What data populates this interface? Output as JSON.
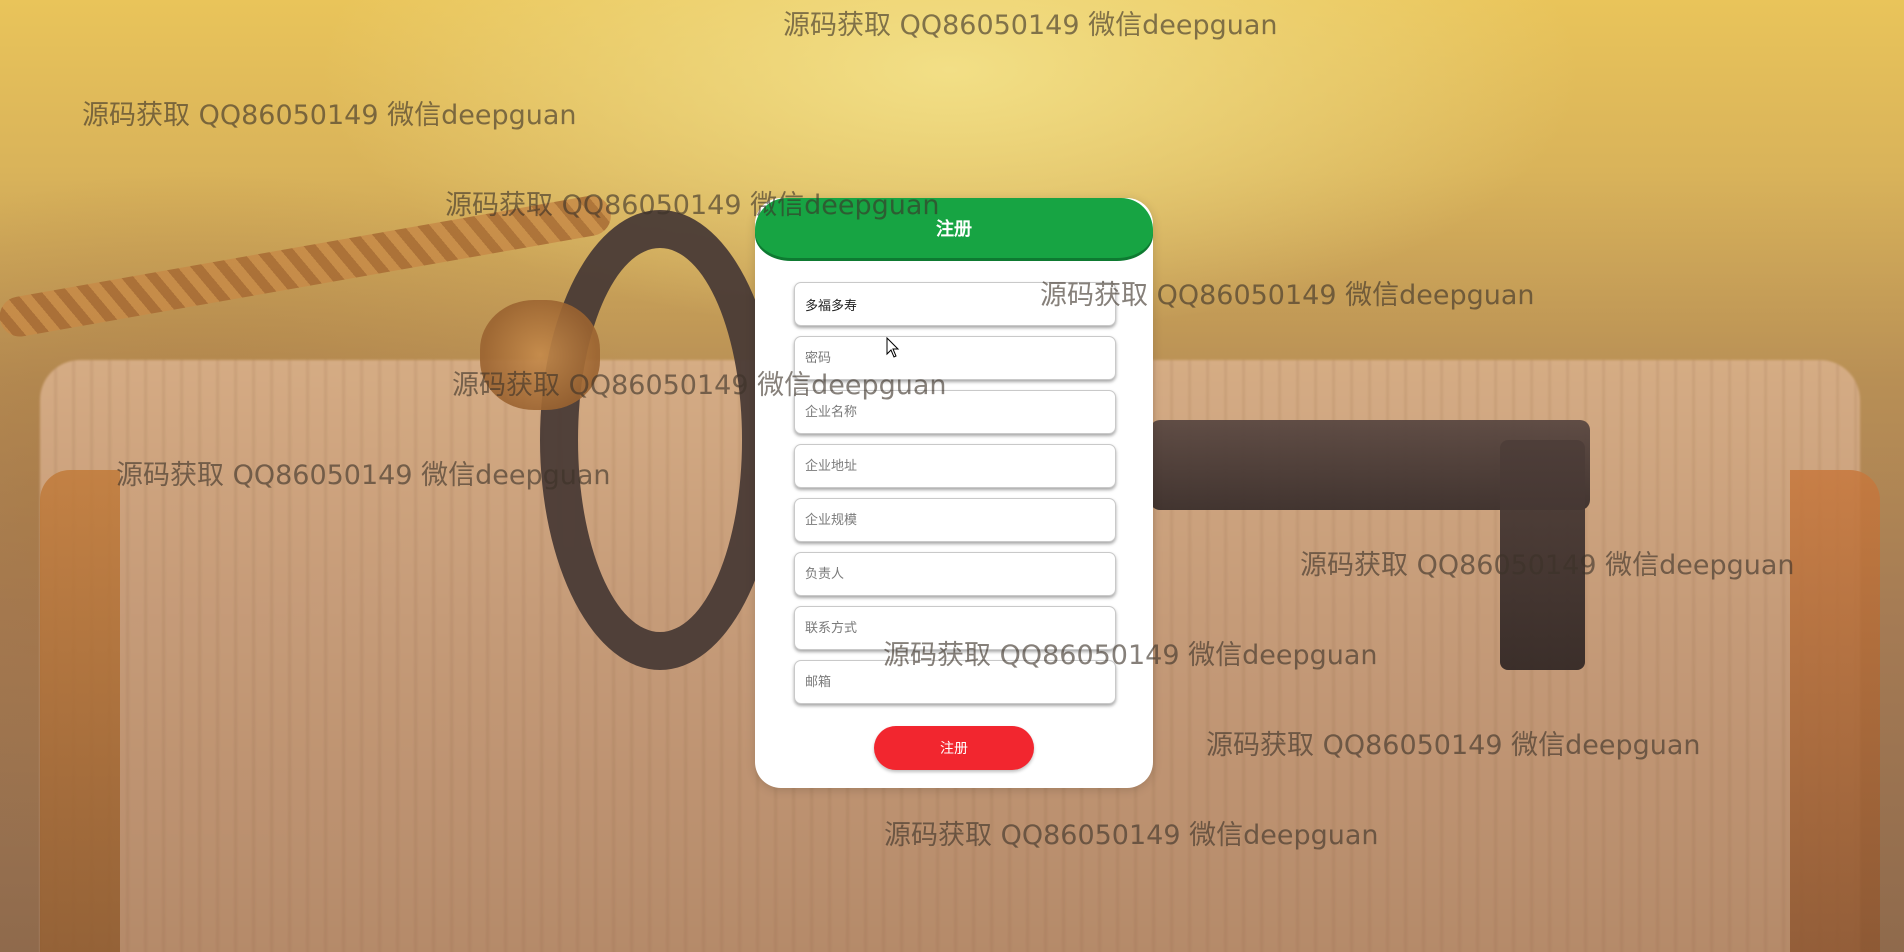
{
  "register_form": {
    "title": "注册",
    "fields": {
      "username": {
        "value": "多福多寿",
        "placeholder": ""
      },
      "password": {
        "value": "",
        "placeholder": "密码"
      },
      "company_name": {
        "value": "",
        "placeholder": "企业名称"
      },
      "company_address": {
        "value": "",
        "placeholder": "企业地址"
      },
      "company_size": {
        "value": "",
        "placeholder": "企业规模"
      },
      "contact_person": {
        "value": "",
        "placeholder": "负责人"
      },
      "phone": {
        "value": "",
        "placeholder": "联系方式"
      },
      "email": {
        "value": "",
        "placeholder": "邮箱"
      }
    },
    "submit_label": "注册"
  },
  "watermark_text": "源码获取 QQ86050149 微信deepguan",
  "colors": {
    "header_green": "#17a443",
    "submit_red": "#f2262f",
    "card_bg": "#ffffff"
  },
  "icons": {
    "cursor": "mouse-pointer-icon"
  }
}
